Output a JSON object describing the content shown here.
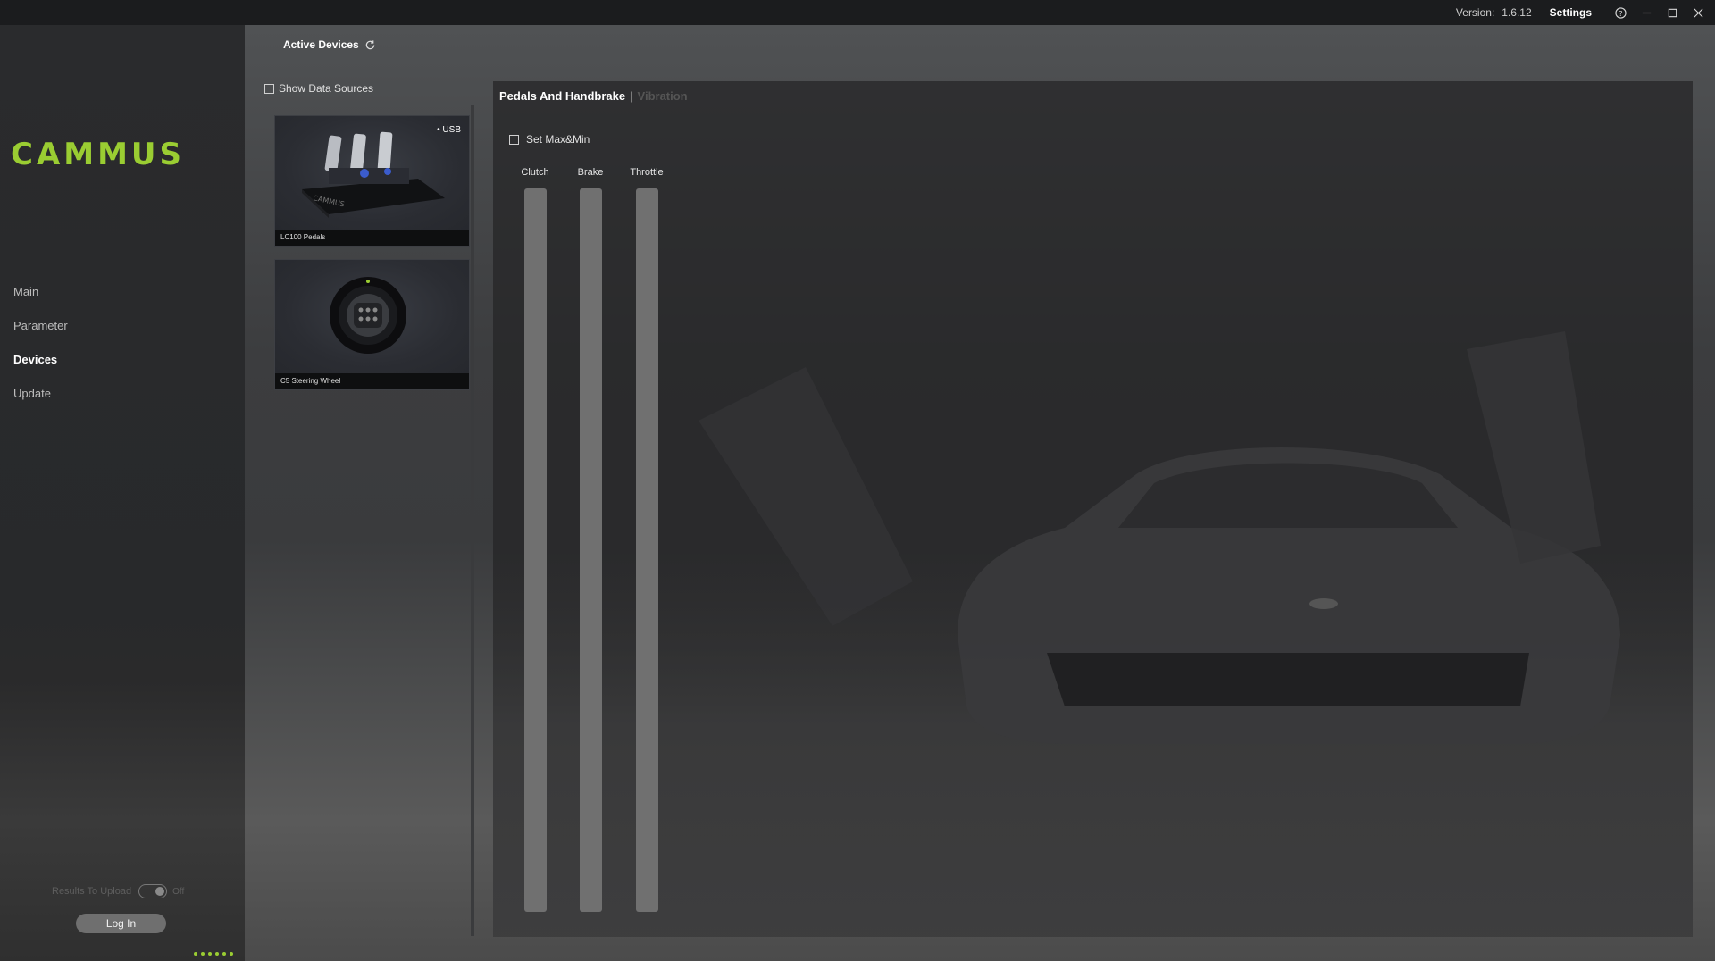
{
  "titlebar": {
    "version_label": "Version:",
    "version_value": "1.6.12",
    "settings_label": "Settings"
  },
  "sidebar": {
    "logo_text": "CAMMUS",
    "accent_color": "#9acd32",
    "items": [
      {
        "label": "Main",
        "active": false
      },
      {
        "label": "Parameter",
        "active": false
      },
      {
        "label": "Devices",
        "active": true
      },
      {
        "label": "Update",
        "active": false
      }
    ],
    "upload_label": "Results To Upload",
    "upload_state": "Off",
    "login_label": "Log In"
  },
  "devices": {
    "header": "Active Devices",
    "show_data_sources_label": "Show Data Sources",
    "show_data_sources_checked": false,
    "cards": [
      {
        "name": "LC100 Pedals",
        "badge": "• USB"
      },
      {
        "name": "C5 Steering Wheel",
        "badge": ""
      }
    ]
  },
  "panel": {
    "tab_active": "Pedals And Handbrake",
    "tab_separator": "|",
    "tab_inactive": "Vibration",
    "set_max_min_label": "Set Max&Min",
    "set_max_min_checked": false,
    "bars": [
      {
        "label": "Clutch",
        "value": 0
      },
      {
        "label": "Brake",
        "value": 0
      },
      {
        "label": "Throttle",
        "value": 0
      }
    ]
  }
}
